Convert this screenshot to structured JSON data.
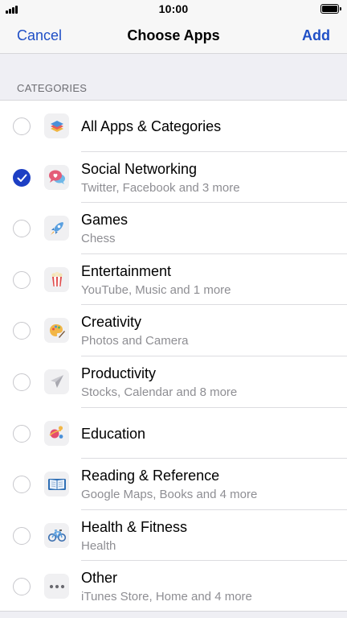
{
  "status_bar": {
    "time": "10:00"
  },
  "nav": {
    "cancel_label": "Cancel",
    "title": "Choose Apps",
    "add_label": "Add"
  },
  "section_header": "CATEGORIES",
  "colors": {
    "accent": "#1f4fc6",
    "checked": "#1d3fc4"
  },
  "categories": [
    {
      "title": "All Apps & Categories",
      "subtitle": "",
      "checked": false,
      "icon": "stack-layers-icon"
    },
    {
      "title": "Social Networking",
      "subtitle": "Twitter, Facebook and 3 more",
      "checked": true,
      "icon": "chat-bubbles-icon"
    },
    {
      "title": "Games",
      "subtitle": "Chess",
      "checked": false,
      "icon": "rocket-icon"
    },
    {
      "title": "Entertainment",
      "subtitle": "YouTube, Music and 1 more",
      "checked": false,
      "icon": "popcorn-icon"
    },
    {
      "title": "Creativity",
      "subtitle": "Photos and Camera",
      "checked": false,
      "icon": "palette-icon"
    },
    {
      "title": "Productivity",
      "subtitle": "Stocks, Calendar and 8 more",
      "checked": false,
      "icon": "paper-plane-icon"
    },
    {
      "title": "Education",
      "subtitle": "",
      "checked": false,
      "icon": "planet-icon"
    },
    {
      "title": "Reading & Reference",
      "subtitle": "Google Maps, Books and 4 more",
      "checked": false,
      "icon": "open-book-icon"
    },
    {
      "title": "Health & Fitness",
      "subtitle": "Health",
      "checked": false,
      "icon": "bicycle-icon"
    },
    {
      "title": "Other",
      "subtitle": "iTunes Store, Home and 4 more",
      "checked": false,
      "icon": "ellipsis-icon"
    }
  ]
}
